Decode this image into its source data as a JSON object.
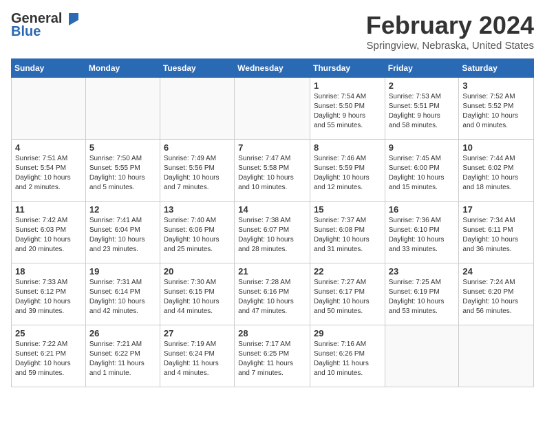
{
  "header": {
    "logo_general": "General",
    "logo_blue": "Blue",
    "month_title": "February 2024",
    "location": "Springview, Nebraska, United States"
  },
  "days_of_week": [
    "Sunday",
    "Monday",
    "Tuesday",
    "Wednesday",
    "Thursday",
    "Friday",
    "Saturday"
  ],
  "weeks": [
    [
      {
        "day": "",
        "info": ""
      },
      {
        "day": "",
        "info": ""
      },
      {
        "day": "",
        "info": ""
      },
      {
        "day": "",
        "info": ""
      },
      {
        "day": "1",
        "info": "Sunrise: 7:54 AM\nSunset: 5:50 PM\nDaylight: 9 hours\nand 55 minutes."
      },
      {
        "day": "2",
        "info": "Sunrise: 7:53 AM\nSunset: 5:51 PM\nDaylight: 9 hours\nand 58 minutes."
      },
      {
        "day": "3",
        "info": "Sunrise: 7:52 AM\nSunset: 5:52 PM\nDaylight: 10 hours\nand 0 minutes."
      }
    ],
    [
      {
        "day": "4",
        "info": "Sunrise: 7:51 AM\nSunset: 5:54 PM\nDaylight: 10 hours\nand 2 minutes."
      },
      {
        "day": "5",
        "info": "Sunrise: 7:50 AM\nSunset: 5:55 PM\nDaylight: 10 hours\nand 5 minutes."
      },
      {
        "day": "6",
        "info": "Sunrise: 7:49 AM\nSunset: 5:56 PM\nDaylight: 10 hours\nand 7 minutes."
      },
      {
        "day": "7",
        "info": "Sunrise: 7:47 AM\nSunset: 5:58 PM\nDaylight: 10 hours\nand 10 minutes."
      },
      {
        "day": "8",
        "info": "Sunrise: 7:46 AM\nSunset: 5:59 PM\nDaylight: 10 hours\nand 12 minutes."
      },
      {
        "day": "9",
        "info": "Sunrise: 7:45 AM\nSunset: 6:00 PM\nDaylight: 10 hours\nand 15 minutes."
      },
      {
        "day": "10",
        "info": "Sunrise: 7:44 AM\nSunset: 6:02 PM\nDaylight: 10 hours\nand 18 minutes."
      }
    ],
    [
      {
        "day": "11",
        "info": "Sunrise: 7:42 AM\nSunset: 6:03 PM\nDaylight: 10 hours\nand 20 minutes."
      },
      {
        "day": "12",
        "info": "Sunrise: 7:41 AM\nSunset: 6:04 PM\nDaylight: 10 hours\nand 23 minutes."
      },
      {
        "day": "13",
        "info": "Sunrise: 7:40 AM\nSunset: 6:06 PM\nDaylight: 10 hours\nand 25 minutes."
      },
      {
        "day": "14",
        "info": "Sunrise: 7:38 AM\nSunset: 6:07 PM\nDaylight: 10 hours\nand 28 minutes."
      },
      {
        "day": "15",
        "info": "Sunrise: 7:37 AM\nSunset: 6:08 PM\nDaylight: 10 hours\nand 31 minutes."
      },
      {
        "day": "16",
        "info": "Sunrise: 7:36 AM\nSunset: 6:10 PM\nDaylight: 10 hours\nand 33 minutes."
      },
      {
        "day": "17",
        "info": "Sunrise: 7:34 AM\nSunset: 6:11 PM\nDaylight: 10 hours\nand 36 minutes."
      }
    ],
    [
      {
        "day": "18",
        "info": "Sunrise: 7:33 AM\nSunset: 6:12 PM\nDaylight: 10 hours\nand 39 minutes."
      },
      {
        "day": "19",
        "info": "Sunrise: 7:31 AM\nSunset: 6:14 PM\nDaylight: 10 hours\nand 42 minutes."
      },
      {
        "day": "20",
        "info": "Sunrise: 7:30 AM\nSunset: 6:15 PM\nDaylight: 10 hours\nand 44 minutes."
      },
      {
        "day": "21",
        "info": "Sunrise: 7:28 AM\nSunset: 6:16 PM\nDaylight: 10 hours\nand 47 minutes."
      },
      {
        "day": "22",
        "info": "Sunrise: 7:27 AM\nSunset: 6:17 PM\nDaylight: 10 hours\nand 50 minutes."
      },
      {
        "day": "23",
        "info": "Sunrise: 7:25 AM\nSunset: 6:19 PM\nDaylight: 10 hours\nand 53 minutes."
      },
      {
        "day": "24",
        "info": "Sunrise: 7:24 AM\nSunset: 6:20 PM\nDaylight: 10 hours\nand 56 minutes."
      }
    ],
    [
      {
        "day": "25",
        "info": "Sunrise: 7:22 AM\nSunset: 6:21 PM\nDaylight: 10 hours\nand 59 minutes."
      },
      {
        "day": "26",
        "info": "Sunrise: 7:21 AM\nSunset: 6:22 PM\nDaylight: 11 hours\nand 1 minute."
      },
      {
        "day": "27",
        "info": "Sunrise: 7:19 AM\nSunset: 6:24 PM\nDaylight: 11 hours\nand 4 minutes."
      },
      {
        "day": "28",
        "info": "Sunrise: 7:17 AM\nSunset: 6:25 PM\nDaylight: 11 hours\nand 7 minutes."
      },
      {
        "day": "29",
        "info": "Sunrise: 7:16 AM\nSunset: 6:26 PM\nDaylight: 11 hours\nand 10 minutes."
      },
      {
        "day": "",
        "info": ""
      },
      {
        "day": "",
        "info": ""
      }
    ]
  ]
}
